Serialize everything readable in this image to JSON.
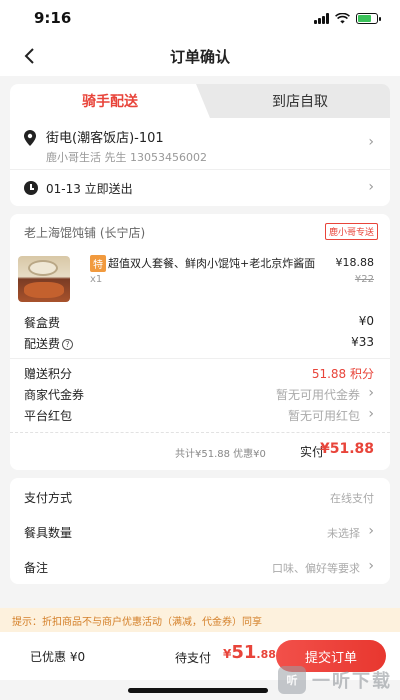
{
  "status_bar": {
    "time": "9:16"
  },
  "nav": {
    "title": "订单确认"
  },
  "tabs": {
    "active": "骑手配送",
    "inactive": "到店自取"
  },
  "address": {
    "main": "街电(潮客饭店)-101",
    "sub": "鹿小哥生活 先生 13053456002"
  },
  "delivery_time": "01-13 立即送出",
  "shop": {
    "name": "老上海馄饨铺 (长宁店)",
    "tag": "鹿小哥专送"
  },
  "item": {
    "badge": "特",
    "name": "超值双人套餐、鲜肉小馄饨+老北京炸酱面",
    "qty": "x1",
    "price": "¥18.88",
    "original_price": "¥22"
  },
  "fees": [
    {
      "label": "餐盒费",
      "value": "¥0"
    },
    {
      "label": "配送费",
      "value": "¥33"
    }
  ],
  "benefits": [
    {
      "label": "赠送积分",
      "value": "51.88 积分"
    },
    {
      "label": "商家代金券",
      "value": "暂无可用代金券"
    },
    {
      "label": "平台红包",
      "value": "暂无可用红包"
    }
  ],
  "totals": {
    "summary": "共计¥51.88  优惠¥0",
    "label": "实付",
    "value": "¥51.88"
  },
  "options": [
    {
      "label": "支付方式",
      "value": "在线支付"
    },
    {
      "label": "餐具数量",
      "value": "未选择"
    },
    {
      "label": "备注",
      "value": "口味、偏好等要求"
    }
  ],
  "tip": "提示：折扣商品不与商户优惠活动（满减，代金券）同享",
  "bottom": {
    "discount": "已优惠 ¥0",
    "pay_label": "待支付",
    "pay_currency": "¥",
    "pay_integer": "51",
    "pay_decimal": ".88",
    "submit": "提交订单"
  },
  "watermark": {
    "logo": "听",
    "text": "一听下载"
  },
  "colors": {
    "accent": "#e8443a",
    "tip_bg": "#fdf1dd",
    "tip_text": "#d4802a"
  }
}
